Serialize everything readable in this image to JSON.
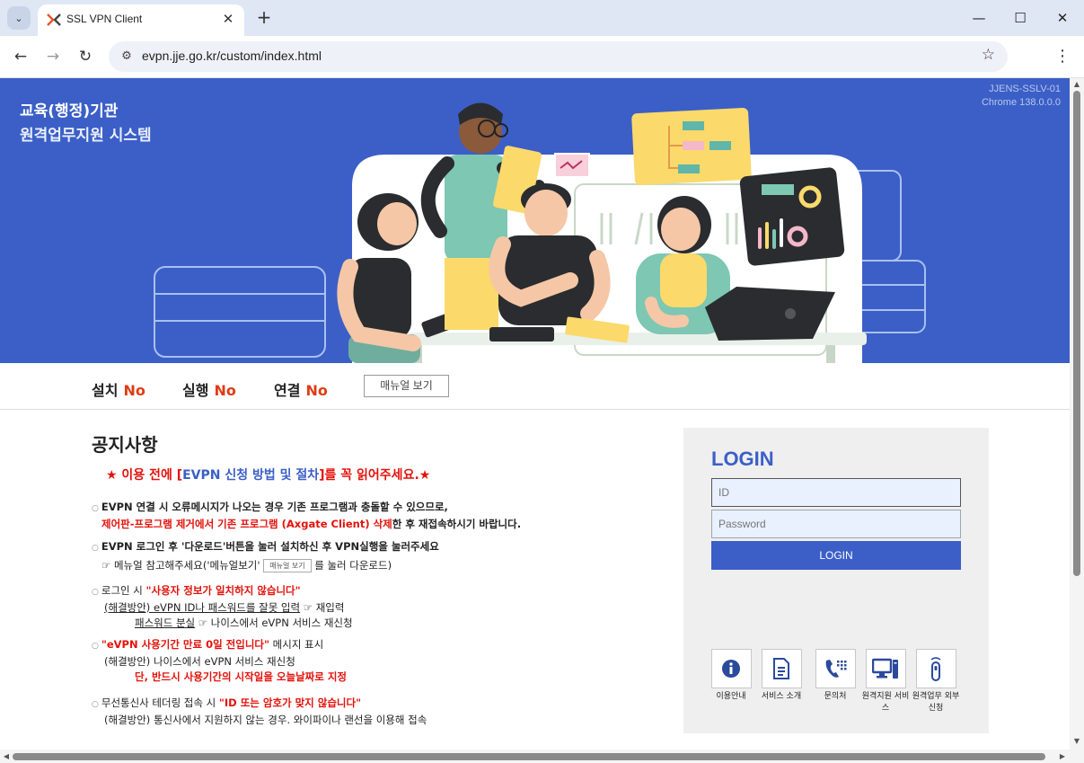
{
  "browser": {
    "tab_title": "SSL VPN Client",
    "url": "evpn.jje.go.kr/custom/index.html"
  },
  "banner": {
    "title_line1": "교육(행정)기관",
    "title_line2": "원격업무지원 시스템",
    "version_line1": "JJENS-SSLV-01",
    "version_line2": "Chrome 138.0.0.0"
  },
  "status": {
    "install_label": "설치",
    "install_value": "No",
    "run_label": "실행",
    "run_value": "No",
    "connect_label": "연결",
    "connect_value": "No",
    "manual_button": "매뉴얼 보기"
  },
  "notice": {
    "title": "공지사항",
    "headline_pre": "★ 이용 전에 [",
    "headline_link": "EVPN 신청 방법 및 절차",
    "headline_post": "]를 꼭 읽어주세요.★",
    "item1_line1": "EVPN 연결 시 오류메시지가 나오는 경우 기존 프로그램과 충돌할 수 있으므로,",
    "item1_line2_red": "제어판-프로그램 제거에서 기존 프로그램 (Axgate Client) 삭제",
    "item1_line2_rest": "한 후 재접속하시기 바랍니다.",
    "item2_line1": "EVPN 로그인 후 '다운로드'버튼을 눌러 설치하신 후 VPN실행을 눌러주세요",
    "item2_line2_pre": "☞ 메뉴얼 참고해주세요('메뉴얼보기'",
    "item2_mini_button": "매뉴얼 보기",
    "item2_line2_post": "를 눌러 다운로드)",
    "item3_line1_pre": "로그인 시 ",
    "item3_line1_red": "\"사용자 정보가 일치하지 않습니다\"",
    "item3_line2_ul": "(해결방안) eVPN ID나 패스워드를 잘못 입력",
    "item3_line2_rest": " ☞ 재입력",
    "item3_line3_ul": "패스워드 분실",
    "item3_line3_rest": " ☞ 나이스에서 eVPN 서비스 재신청",
    "item4_line1_red": "\"eVPN 사용기간 만료 0일 전입니다\"",
    "item4_line1_rest": " 메시지 표시",
    "item4_line2": "(해결방안) 나이스에서 eVPN 서비스 재신청",
    "item4_line3_red": "단, 반드시 사용기간의 시작일을 오늘날짜로 지정",
    "item5_line1_pre": "무선통신사 테더링 접속 시 ",
    "item5_line1_red": "\"ID 또는 암호가 맞지 않습니다\"",
    "item5_line2": "(해결방안) 통신사에서 지원하지 않는 경우. 와이파이나 랜선을 이용해 접속"
  },
  "login": {
    "title": "LOGIN",
    "id_placeholder": "ID",
    "pw_placeholder": "Password",
    "button": "LOGIN",
    "links": [
      {
        "label": "이용안내",
        "icon": "info-icon"
      },
      {
        "label": "서비스 소개",
        "icon": "document-icon"
      },
      {
        "label": "문의처",
        "icon": "phone-icon"
      },
      {
        "label": "원격지원 서비스",
        "icon": "computer-icon"
      },
      {
        "label": "원격업무 외부신청",
        "icon": "remote-icon"
      }
    ]
  },
  "colors": {
    "brand_blue": "#3b5fc7",
    "status_red": "#e03c14",
    "notice_red": "#e3120b"
  }
}
